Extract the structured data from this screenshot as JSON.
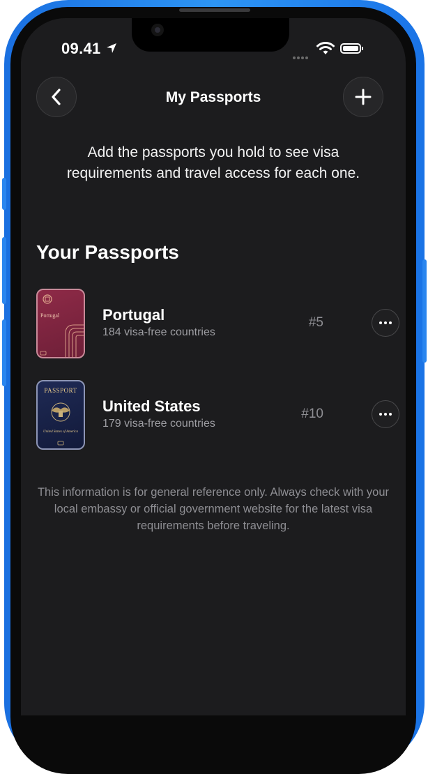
{
  "status_bar": {
    "time": "09.41"
  },
  "header": {
    "title": "My Passports"
  },
  "intro_text": "Add the passports you hold to see visa requirements and travel access for each one.",
  "section_title": "Your Passports",
  "passports": [
    {
      "country": "Portugal",
      "visa_free": "184 visa-free countries",
      "rank": "#5",
      "cover_color": "#7d2540",
      "cover_label": "Portugal"
    },
    {
      "country": "United States",
      "visa_free": "179 visa-free countries",
      "rank": "#10",
      "cover_color": "#18214a",
      "cover_label": "PASSPORT",
      "cover_sublabel": "United States of America"
    }
  ],
  "disclaimer": "This information is for general reference only. Always check with your local embassy or official government website for the latest visa requirements before traveling.",
  "colors": {
    "background": "#1c1c1e",
    "frame": "#2d95f5",
    "muted_text": "#8e8e93"
  }
}
